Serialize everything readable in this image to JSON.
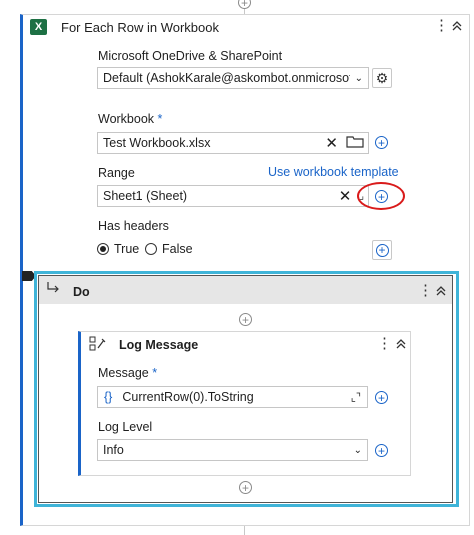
{
  "outer": {
    "title": "For Each Row in Workbook",
    "icon_text": "X",
    "icon_color": "#1d7044",
    "connection_label": "Microsoft OneDrive & SharePoint",
    "connection_value": "Default (AshokKarale@askombot.onmicrosoft....",
    "workbook_label": "Workbook",
    "workbook_required": "*",
    "workbook_value": "Test Workbook.xlsx",
    "range_label": "Range",
    "range_link": "Use workbook template",
    "range_value": "Sheet1 (Sheet)",
    "headers_label": "Has headers",
    "radio_true": "True",
    "radio_false": "False",
    "radio_selected": "True"
  },
  "do": {
    "title": "Do"
  },
  "log": {
    "title": "Log Message",
    "message_label": "Message",
    "message_required": "*",
    "message_braces": "{}",
    "message_value": "CurrentRow(0).ToString",
    "level_label": "Log Level",
    "level_value": "Info"
  },
  "colors": {
    "accent": "#1a64c8",
    "selection_border": "#3fb4d8",
    "annotation": "#d91a1a"
  },
  "icons": [
    "excel-icon",
    "kebab-icon",
    "chevron-up-icon",
    "settings-gear-icon",
    "close-icon",
    "folder-icon",
    "plus-circle-icon",
    "branch-arrow-icon",
    "log-message-icon",
    "expand-icon",
    "chevron-down-icon"
  ]
}
